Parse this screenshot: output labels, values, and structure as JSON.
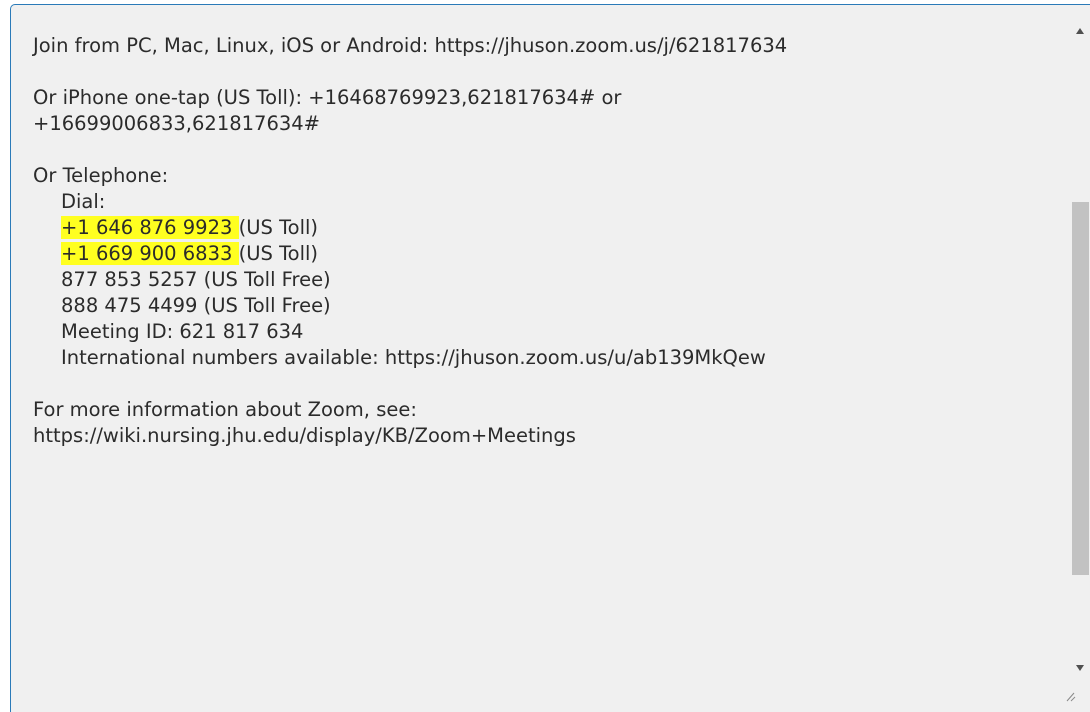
{
  "meeting_text": {
    "join_line": "Join from PC, Mac, Linux, iOS or Android: https://jhuson.zoom.us/j/621817634",
    "iphone_line_1": "Or iPhone one-tap (US Toll):  +16468769923,621817634#  or",
    "iphone_line_2": "+16699006833,621817634#",
    "telephone_heading": "Or Telephone:",
    "dial_label": "Dial:",
    "phone_1_number": "+1 646 876 9923 ",
    "phone_1_suffix": "(US Toll)",
    "phone_2_number": "+1 669 900 6833 ",
    "phone_2_suffix": "(US Toll)",
    "phone_3": "877 853 5257 (US Toll Free)",
    "phone_4": "888 475 4499 (US Toll Free)",
    "meeting_id": "Meeting ID: 621 817 634",
    "international": "International numbers available: https://jhuson.zoom.us/u/ab139MkQew",
    "more_info_1": "For more information about Zoom, see:",
    "more_info_2": "https://wiki.nursing.jhu.edu/display/KB/Zoom+Meetings"
  },
  "colors": {
    "highlight": "#ffff20",
    "border_focus": "#2a7ab8"
  },
  "icons": {
    "scroll_up": "arrow-up-icon",
    "scroll_down": "arrow-down-icon",
    "resize": "resize-grip-icon"
  }
}
